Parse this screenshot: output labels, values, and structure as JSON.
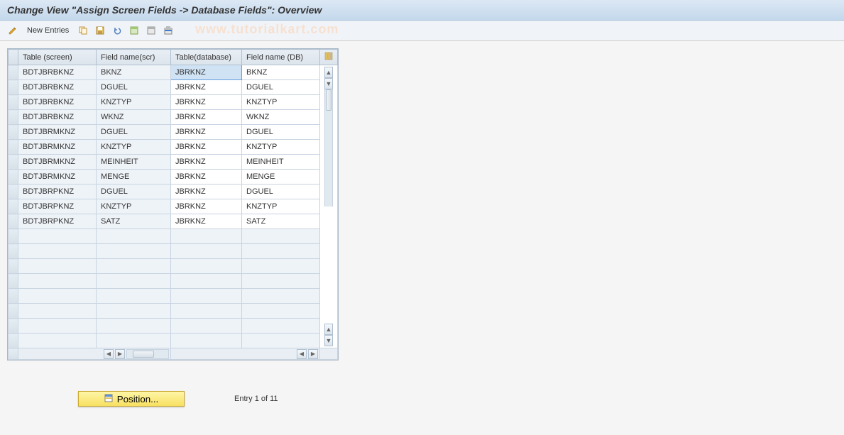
{
  "title": "Change View \"Assign Screen Fields -> Database Fields\": Overview",
  "toolbar": {
    "new_entries": "New Entries"
  },
  "watermark": "www.tutorialkart.com",
  "columns": {
    "c1": "Table (screen)",
    "c2": "Field name(scr)",
    "c3": "Table(database)",
    "c4": "Field name (DB)"
  },
  "rows": [
    {
      "t": "BDTJBRBKNZ",
      "f": "BKNZ",
      "td": "JBRKNZ",
      "fd": "BKNZ"
    },
    {
      "t": "BDTJBRBKNZ",
      "f": "DGUEL",
      "td": "JBRKNZ",
      "fd": "DGUEL"
    },
    {
      "t": "BDTJBRBKNZ",
      "f": "KNZTYP",
      "td": "JBRKNZ",
      "fd": "KNZTYP"
    },
    {
      "t": "BDTJBRBKNZ",
      "f": "WKNZ",
      "td": "JBRKNZ",
      "fd": "WKNZ"
    },
    {
      "t": "BDTJBRMKNZ",
      "f": "DGUEL",
      "td": "JBRKNZ",
      "fd": "DGUEL"
    },
    {
      "t": "BDTJBRMKNZ",
      "f": "KNZTYP",
      "td": "JBRKNZ",
      "fd": "KNZTYP"
    },
    {
      "t": "BDTJBRMKNZ",
      "f": "MEINHEIT",
      "td": "JBRKNZ",
      "fd": "MEINHEIT"
    },
    {
      "t": "BDTJBRMKNZ",
      "f": "MENGE",
      "td": "JBRKNZ",
      "fd": "MENGE"
    },
    {
      "t": "BDTJBRPKNZ",
      "f": "DGUEL",
      "td": "JBRKNZ",
      "fd": "DGUEL"
    },
    {
      "t": "BDTJBRPKNZ",
      "f": "KNZTYP",
      "td": "JBRKNZ",
      "fd": "KNZTYP"
    },
    {
      "t": "BDTJBRPKNZ",
      "f": "SATZ",
      "td": "JBRKNZ",
      "fd": "SATZ"
    }
  ],
  "footer": {
    "position_label": "Position...",
    "entry_info": "Entry 1 of 11"
  }
}
